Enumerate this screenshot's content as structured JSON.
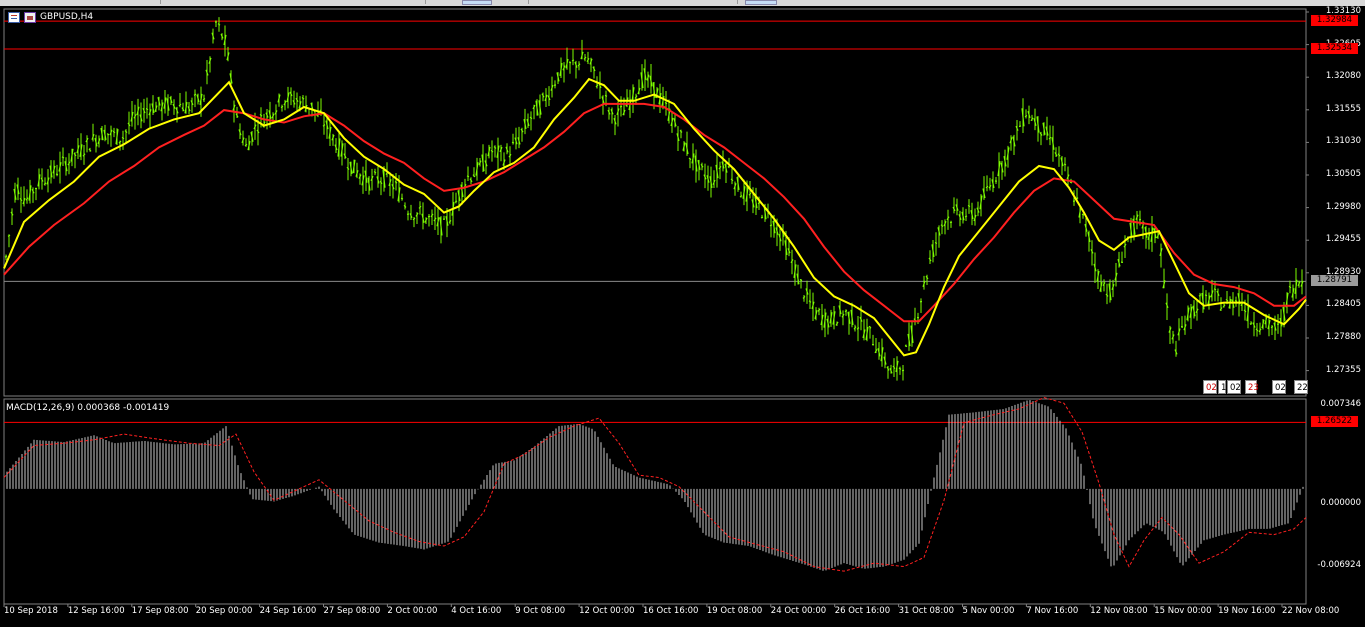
{
  "window": {
    "title": "GBPUSD,H4"
  },
  "price_axis": {
    "labels": [
      "1.33130",
      "1.32605",
      "1.32080",
      "1.31555",
      "1.31030",
      "1.30505",
      "1.29980",
      "1.29455",
      "1.28930",
      "1.28405",
      "1.27880",
      "1.27355"
    ],
    "current_price": "1.28791",
    "line_tags": [
      "1.32984",
      "1.32534",
      "1.26522"
    ]
  },
  "macd": {
    "label": "MACD(12,26,9) 0.000368 -0.001419",
    "axis": [
      "0.007346",
      "0.000000",
      "-0.006924"
    ]
  },
  "time_axis": [
    "10 Sep 2018",
    "12 Sep 16:00",
    "17 Sep 08:00",
    "20 Sep 00:00",
    "24 Sep 16:00",
    "27 Sep 08:00",
    "2 Oct 00:00",
    "4 Oct 16:00",
    "9 Oct 08:00",
    "12 Oct 00:00",
    "16 Oct 16:00",
    "19 Oct 08:00",
    "24 Oct 00:00",
    "26 Oct 16:00",
    "31 Oct 08:00",
    "5 Nov 00:00",
    "7 Nov 16:00",
    "12 Nov 08:00",
    "15 Nov 00:00",
    "19 Nov 16:00",
    "22 Nov 08:00"
  ],
  "time_tags": [
    "02:",
    "1",
    "02",
    "23",
    "02",
    "22:"
  ],
  "colors": {
    "candle": "#7cfc00",
    "ma_fast": "#ffff00",
    "ma_slow": "#ff2020",
    "hline": "#ff0000",
    "grid": "#7f7f7f",
    "macd_hist": "#c8c8c8",
    "macd_signal": "#ff2020"
  },
  "chart_data": {
    "type": "line",
    "title": "GBPUSD,H4",
    "ylim": [
      1.2707,
      1.3313
    ],
    "price_path": [
      [
        0,
        1.2895
      ],
      [
        12,
        1.3035
      ],
      [
        22,
        1.301
      ],
      [
        35,
        1.304
      ],
      [
        50,
        1.3055
      ],
      [
        65,
        1.3075
      ],
      [
        80,
        1.3095
      ],
      [
        100,
        1.312
      ],
      [
        118,
        1.311
      ],
      [
        128,
        1.3138
      ],
      [
        145,
        1.316
      ],
      [
        170,
        1.3165
      ],
      [
        185,
        1.316
      ],
      [
        200,
        1.3178
      ],
      [
        212,
        1.3295
      ],
      [
        222,
        1.326
      ],
      [
        232,
        1.3145
      ],
      [
        242,
        1.3095
      ],
      [
        252,
        1.313
      ],
      [
        265,
        1.315
      ],
      [
        280,
        1.3175
      ],
      [
        295,
        1.317
      ],
      [
        308,
        1.316
      ],
      [
        320,
        1.3135
      ],
      [
        335,
        1.3095
      ],
      [
        350,
        1.306
      ],
      [
        365,
        1.304
      ],
      [
        380,
        1.3045
      ],
      [
        392,
        1.303
      ],
      [
        405,
        1.2995
      ],
      [
        418,
        1.2985
      ],
      [
        430,
        1.2975
      ],
      [
        440,
        1.2965
      ],
      [
        450,
        1.3
      ],
      [
        462,
        1.3045
      ],
      [
        475,
        1.306
      ],
      [
        488,
        1.309
      ],
      [
        500,
        1.308
      ],
      [
        512,
        1.31
      ],
      [
        525,
        1.314
      ],
      [
        540,
        1.317
      ],
      [
        555,
        1.3215
      ],
      [
        570,
        1.323
      ],
      [
        582,
        1.324
      ],
      [
        590,
        1.3215
      ],
      [
        600,
        1.3175
      ],
      [
        608,
        1.3145
      ],
      [
        618,
        1.315
      ],
      [
        628,
        1.3175
      ],
      [
        640,
        1.321
      ],
      [
        652,
        1.3185
      ],
      [
        665,
        1.315
      ],
      [
        680,
        1.31
      ],
      [
        695,
        1.306
      ],
      [
        708,
        1.304
      ],
      [
        720,
        1.3075
      ],
      [
        735,
        1.303
      ],
      [
        750,
        1.3005
      ],
      [
        765,
        1.2985
      ],
      [
        780,
        1.2945
      ],
      [
        795,
        1.288
      ],
      [
        810,
        1.283
      ],
      [
        825,
        1.2815
      ],
      [
        840,
        1.283
      ],
      [
        855,
        1.281
      ],
      [
        868,
        1.279
      ],
      [
        878,
        1.276
      ],
      [
        888,
        1.273
      ],
      [
        898,
        1.2745
      ],
      [
        908,
        1.2795
      ],
      [
        918,
        1.286
      ],
      [
        928,
        1.2925
      ],
      [
        940,
        1.298
      ],
      [
        955,
        1.299
      ],
      [
        970,
        1.2985
      ],
      [
        985,
        1.303
      ],
      [
        1000,
        1.3075
      ],
      [
        1012,
        1.3115
      ],
      [
        1022,
        1.3155
      ],
      [
        1035,
        1.313
      ],
      [
        1048,
        1.3105
      ],
      [
        1060,
        1.306
      ],
      [
        1072,
        1.301
      ],
      [
        1085,
        1.295
      ],
      [
        1095,
        1.288
      ],
      [
        1108,
        1.286
      ],
      [
        1120,
        1.2935
      ],
      [
        1132,
        1.2975
      ],
      [
        1145,
        1.295
      ],
      [
        1155,
        1.296
      ],
      [
        1165,
        1.28
      ],
      [
        1172,
        1.2775
      ],
      [
        1182,
        1.282
      ],
      [
        1195,
        1.2845
      ],
      [
        1210,
        1.2855
      ],
      [
        1222,
        1.284
      ],
      [
        1235,
        1.2855
      ],
      [
        1248,
        1.2815
      ],
      [
        1262,
        1.281
      ],
      [
        1275,
        1.28
      ],
      [
        1285,
        1.286
      ],
      [
        1295,
        1.288
      ],
      [
        1302,
        1.2879
      ]
    ],
    "ma_fast_path": [
      [
        0,
        1.29
      ],
      [
        20,
        1.2975
      ],
      [
        45,
        1.301
      ],
      [
        70,
        1.304
      ],
      [
        95,
        1.308
      ],
      [
        120,
        1.31
      ],
      [
        145,
        1.3125
      ],
      [
        170,
        1.314
      ],
      [
        195,
        1.315
      ],
      [
        210,
        1.3175
      ],
      [
        225,
        1.32
      ],
      [
        240,
        1.315
      ],
      [
        260,
        1.313
      ],
      [
        280,
        1.314
      ],
      [
        300,
        1.316
      ],
      [
        320,
        1.315
      ],
      [
        340,
        1.311
      ],
      [
        360,
        1.308
      ],
      [
        380,
        1.306
      ],
      [
        400,
        1.3035
      ],
      [
        420,
        1.302
      ],
      [
        440,
        1.299
      ],
      [
        455,
        1.3
      ],
      [
        470,
        1.3025
      ],
      [
        490,
        1.3055
      ],
      [
        510,
        1.307
      ],
      [
        530,
        1.3095
      ],
      [
        550,
        1.314
      ],
      [
        570,
        1.3175
      ],
      [
        585,
        1.3205
      ],
      [
        600,
        1.3195
      ],
      [
        615,
        1.317
      ],
      [
        630,
        1.317
      ],
      [
        650,
        1.318
      ],
      [
        670,
        1.3165
      ],
      [
        690,
        1.3125
      ],
      [
        710,
        1.309
      ],
      [
        730,
        1.306
      ],
      [
        750,
        1.302
      ],
      [
        770,
        1.298
      ],
      [
        790,
        1.2935
      ],
      [
        810,
        1.2885
      ],
      [
        830,
        1.2855
      ],
      [
        850,
        1.284
      ],
      [
        870,
        1.282
      ],
      [
        885,
        1.279
      ],
      [
        900,
        1.276
      ],
      [
        912,
        1.2765
      ],
      [
        925,
        1.281
      ],
      [
        940,
        1.287
      ],
      [
        955,
        1.292
      ],
      [
        975,
        1.296
      ],
      [
        995,
        1.3
      ],
      [
        1015,
        1.304
      ],
      [
        1035,
        1.3065
      ],
      [
        1050,
        1.306
      ],
      [
        1065,
        1.303
      ],
      [
        1080,
        1.299
      ],
      [
        1095,
        1.2945
      ],
      [
        1110,
        1.293
      ],
      [
        1125,
        1.295
      ],
      [
        1140,
        1.2955
      ],
      [
        1155,
        1.296
      ],
      [
        1170,
        1.291
      ],
      [
        1185,
        1.286
      ],
      [
        1200,
        1.284
      ],
      [
        1220,
        1.2845
      ],
      [
        1240,
        1.2845
      ],
      [
        1260,
        1.2825
      ],
      [
        1280,
        1.281
      ],
      [
        1295,
        1.2835
      ],
      [
        1302,
        1.285
      ]
    ],
    "ma_slow_path": [
      [
        0,
        1.289
      ],
      [
        25,
        1.2935
      ],
      [
        50,
        1.297
      ],
      [
        80,
        1.3005
      ],
      [
        105,
        1.304
      ],
      [
        130,
        1.3065
      ],
      [
        155,
        1.3095
      ],
      [
        180,
        1.3115
      ],
      [
        200,
        1.313
      ],
      [
        220,
        1.3155
      ],
      [
        240,
        1.315
      ],
      [
        260,
        1.314
      ],
      [
        280,
        1.3135
      ],
      [
        300,
        1.3145
      ],
      [
        320,
        1.315
      ],
      [
        340,
        1.313
      ],
      [
        360,
        1.3105
      ],
      [
        380,
        1.3085
      ],
      [
        400,
        1.307
      ],
      [
        420,
        1.3045
      ],
      [
        440,
        1.3025
      ],
      [
        460,
        1.303
      ],
      [
        480,
        1.304
      ],
      [
        500,
        1.3055
      ],
      [
        520,
        1.3075
      ],
      [
        540,
        1.3095
      ],
      [
        560,
        1.312
      ],
      [
        580,
        1.315
      ],
      [
        600,
        1.3165
      ],
      [
        620,
        1.3165
      ],
      [
        640,
        1.3165
      ],
      [
        660,
        1.316
      ],
      [
        680,
        1.314
      ],
      [
        700,
        1.3115
      ],
      [
        720,
        1.3095
      ],
      [
        740,
        1.307
      ],
      [
        760,
        1.3045
      ],
      [
        780,
        1.3015
      ],
      [
        800,
        1.298
      ],
      [
        820,
        1.2935
      ],
      [
        840,
        1.2895
      ],
      [
        860,
        1.2865
      ],
      [
        880,
        1.284
      ],
      [
        900,
        1.2815
      ],
      [
        915,
        1.2815
      ],
      [
        930,
        1.284
      ],
      [
        950,
        1.2875
      ],
      [
        970,
        1.2915
      ],
      [
        990,
        1.295
      ],
      [
        1010,
        1.299
      ],
      [
        1030,
        1.3025
      ],
      [
        1050,
        1.3045
      ],
      [
        1070,
        1.304
      ],
      [
        1090,
        1.301
      ],
      [
        1110,
        1.298
      ],
      [
        1130,
        1.2975
      ],
      [
        1150,
        1.297
      ],
      [
        1170,
        1.2925
      ],
      [
        1190,
        1.289
      ],
      [
        1210,
        1.2875
      ],
      [
        1230,
        1.287
      ],
      [
        1250,
        1.286
      ],
      [
        1270,
        1.284
      ],
      [
        1290,
        1.284
      ],
      [
        1302,
        1.2855
      ]
    ],
    "hlines": [
      1.32984,
      1.32534,
      1.26522
    ],
    "current_price_line": 1.28791,
    "macd_range": [
      -0.006924,
      0.007346
    ],
    "macd_hist_path": [
      [
        0,
        0.0012
      ],
      [
        30,
        0.0043
      ],
      [
        60,
        0.0041
      ],
      [
        90,
        0.0047
      ],
      [
        110,
        0.004
      ],
      [
        140,
        0.0042
      ],
      [
        170,
        0.0039
      ],
      [
        200,
        0.004
      ],
      [
        222,
        0.0055
      ],
      [
        235,
        0.0018
      ],
      [
        248,
        -0.0009
      ],
      [
        270,
        -0.0011
      ],
      [
        290,
        -0.0006
      ],
      [
        315,
        0.0002
      ],
      [
        330,
        -0.0018
      ],
      [
        350,
        -0.004
      ],
      [
        375,
        -0.0047
      ],
      [
        400,
        -0.005
      ],
      [
        420,
        -0.0053
      ],
      [
        445,
        -0.0046
      ],
      [
        470,
        -0.0006
      ],
      [
        490,
        0.0022
      ],
      [
        510,
        0.0025
      ],
      [
        530,
        0.0037
      ],
      [
        555,
        0.0055
      ],
      [
        575,
        0.0057
      ],
      [
        590,
        0.0052
      ],
      [
        610,
        0.002
      ],
      [
        635,
        0.001
      ],
      [
        665,
        0.0004
      ],
      [
        680,
        -0.001
      ],
      [
        700,
        -0.004
      ],
      [
        720,
        -0.0047
      ],
      [
        745,
        -0.005
      ],
      [
        770,
        -0.0058
      ],
      [
        800,
        -0.0066
      ],
      [
        820,
        -0.0072
      ],
      [
        840,
        -0.0065
      ],
      [
        860,
        -0.007
      ],
      [
        880,
        -0.0068
      ],
      [
        900,
        -0.0062
      ],
      [
        915,
        -0.0048
      ],
      [
        930,
        0.001
      ],
      [
        945,
        0.0065
      ],
      [
        970,
        0.0067
      ],
      [
        1000,
        0.007
      ],
      [
        1025,
        0.0078
      ],
      [
        1045,
        0.0072
      ],
      [
        1062,
        0.0053
      ],
      [
        1078,
        0.002
      ],
      [
        1090,
        -0.003
      ],
      [
        1108,
        -0.007
      ],
      [
        1125,
        -0.0045
      ],
      [
        1142,
        -0.003
      ],
      [
        1160,
        -0.0038
      ],
      [
        1178,
        -0.0068
      ],
      [
        1200,
        -0.0045
      ],
      [
        1220,
        -0.004
      ],
      [
        1245,
        -0.0035
      ],
      [
        1265,
        -0.0035
      ],
      [
        1285,
        -0.003
      ],
      [
        1300,
        0.0004
      ]
    ],
    "macd_signal_path": [
      [
        0,
        0.001
      ],
      [
        30,
        0.0038
      ],
      [
        60,
        0.004
      ],
      [
        90,
        0.0043
      ],
      [
        120,
        0.0048
      ],
      [
        150,
        0.0044
      ],
      [
        185,
        0.004
      ],
      [
        215,
        0.0038
      ],
      [
        232,
        0.0048
      ],
      [
        250,
        0.0015
      ],
      [
        270,
        -0.001
      ],
      [
        290,
        -0.0002
      ],
      [
        315,
        0.0008
      ],
      [
        340,
        -0.001
      ],
      [
        365,
        -0.0028
      ],
      [
        390,
        -0.0038
      ],
      [
        415,
        -0.0046
      ],
      [
        440,
        -0.005
      ],
      [
        460,
        -0.0042
      ],
      [
        480,
        -0.002
      ],
      [
        500,
        0.0022
      ],
      [
        520,
        0.003
      ],
      [
        545,
        0.0045
      ],
      [
        570,
        0.0055
      ],
      [
        595,
        0.0062
      ],
      [
        615,
        0.004
      ],
      [
        635,
        0.0012
      ],
      [
        655,
        0.001
      ],
      [
        675,
        0.0002
      ],
      [
        700,
        -0.002
      ],
      [
        725,
        -0.0042
      ],
      [
        750,
        -0.0048
      ],
      [
        780,
        -0.0055
      ],
      [
        810,
        -0.0068
      ],
      [
        840,
        -0.0072
      ],
      [
        870,
        -0.0065
      ],
      [
        900,
        -0.0068
      ],
      [
        920,
        -0.006
      ],
      [
        940,
        -0.001
      ],
      [
        960,
        0.0058
      ],
      [
        990,
        0.0065
      ],
      [
        1015,
        0.007
      ],
      [
        1040,
        0.008
      ],
      [
        1060,
        0.0075
      ],
      [
        1078,
        0.005
      ],
      [
        1095,
        0.0005
      ],
      [
        1110,
        -0.004
      ],
      [
        1125,
        -0.0068
      ],
      [
        1140,
        -0.0045
      ],
      [
        1158,
        -0.0025
      ],
      [
        1175,
        -0.004
      ],
      [
        1195,
        -0.0065
      ],
      [
        1220,
        -0.0055
      ],
      [
        1245,
        -0.0038
      ],
      [
        1270,
        -0.004
      ],
      [
        1290,
        -0.0035
      ],
      [
        1302,
        -0.0025
      ]
    ]
  }
}
